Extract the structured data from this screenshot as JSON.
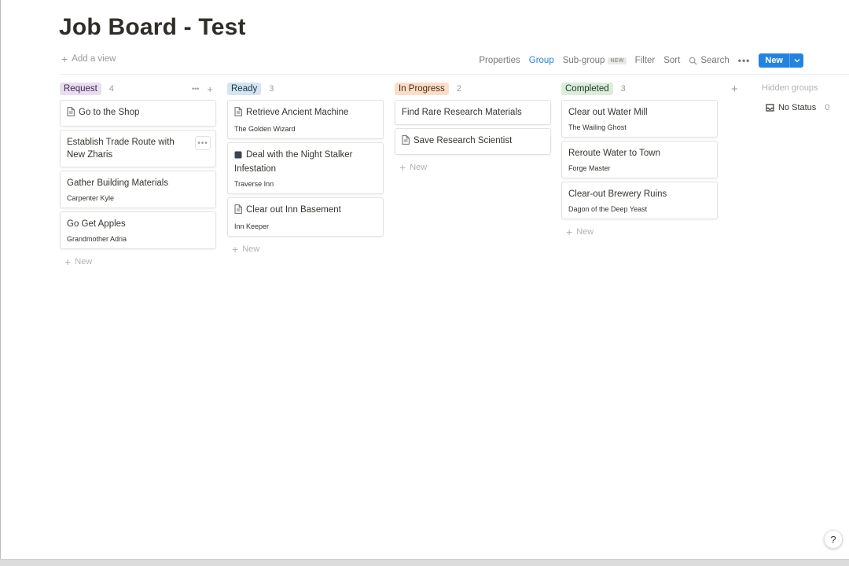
{
  "page": {
    "title": "Job Board - Test"
  },
  "toolbar": {
    "add_view": "Add a view",
    "properties": "Properties",
    "group": "Group",
    "subgroup": "Sub-group",
    "subgroup_badge": "NEW",
    "filter": "Filter",
    "sort": "Sort",
    "search": "Search",
    "more": "•••",
    "new_button": "New"
  },
  "colors": {
    "accent": "#2383e2"
  },
  "columns": [
    {
      "status": "Request",
      "count": "4",
      "pill_bg": "#e8deee",
      "pill_fg": "#412454",
      "cards": [
        {
          "title": "Go to the Shop",
          "icon": "page-icon",
          "sub": ""
        },
        {
          "title": "Establish Trade Route with New Zharis",
          "icon": "",
          "sub": ""
        },
        {
          "title": "Gather Building Materials",
          "icon": "",
          "sub": "Carpenter Kyle"
        },
        {
          "title": "Go Get Apples",
          "icon": "",
          "sub": "Grandmother Adria"
        }
      ],
      "new_label": "New"
    },
    {
      "status": "Ready",
      "count": "3",
      "pill_bg": "#d3e5ef",
      "pill_fg": "#183347",
      "cards": [
        {
          "title": "Retrieve Ancient Machine",
          "icon": "page-icon",
          "sub": "The Golden Wizard"
        },
        {
          "title": "Deal with the Night Stalker Infestation",
          "icon": "dark-square-icon",
          "sub": "Traverse Inn"
        },
        {
          "title": "Clear out Inn Basement",
          "icon": "page-icon",
          "sub": "Inn Keeper"
        }
      ],
      "new_label": "New"
    },
    {
      "status": "In Progress",
      "count": "2",
      "pill_bg": "#fadec9",
      "pill_fg": "#49290e",
      "cards": [
        {
          "title": "Find Rare Research Materials",
          "icon": "",
          "sub": ""
        },
        {
          "title": "Save Research Scientist",
          "icon": "page-icon",
          "sub": ""
        }
      ],
      "new_label": "New"
    },
    {
      "status": "Completed",
      "count": "3",
      "pill_bg": "#dbeddb",
      "pill_fg": "#1c3829",
      "cards": [
        {
          "title": "Clear out Water Mill",
          "icon": "",
          "sub": "The Wailing Ghost"
        },
        {
          "title": "Reroute Water to Town",
          "icon": "",
          "sub": "Forge Master"
        },
        {
          "title": "Clear-out Brewery Ruins",
          "icon": "",
          "sub": "Dagon of the Deep Yeast"
        }
      ],
      "new_label": "New"
    }
  ],
  "hidden": {
    "label": "Hidden groups",
    "no_status": "No Status",
    "no_status_count": "0"
  },
  "help": "?"
}
